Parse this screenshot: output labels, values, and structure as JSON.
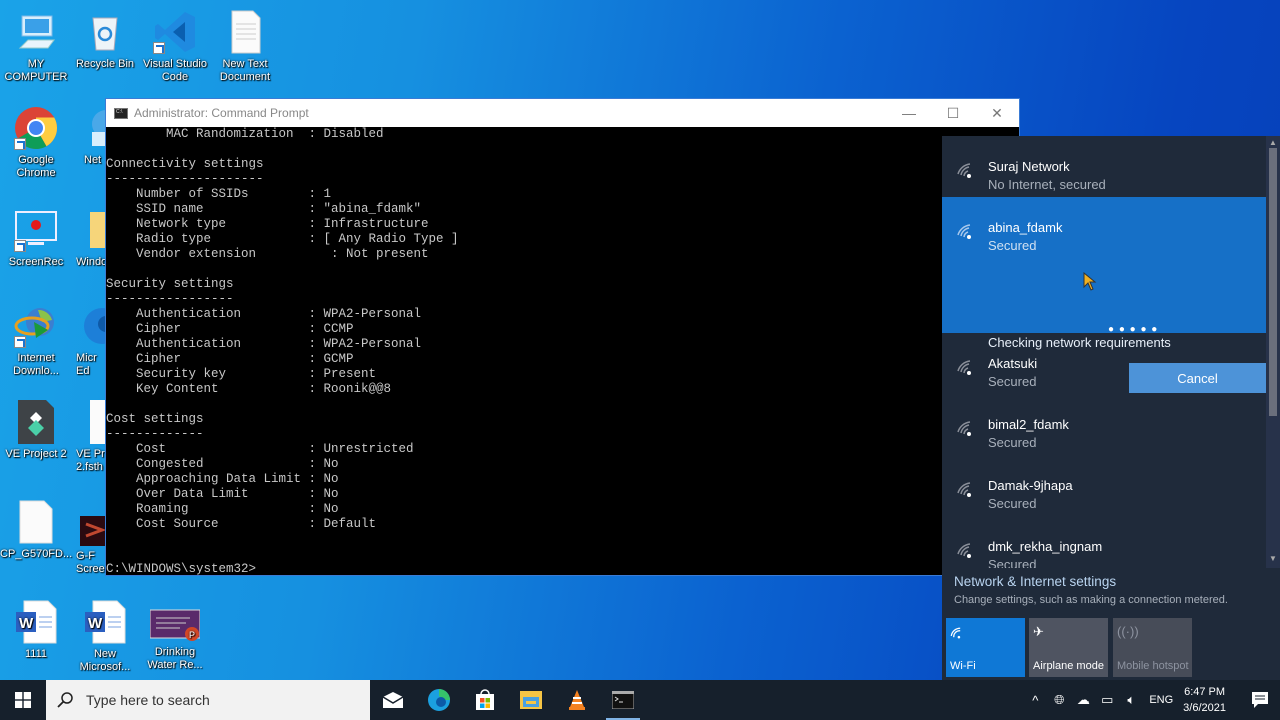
{
  "desktop": {
    "icons": [
      {
        "label": "MY COMPUTER",
        "icon": "computer-icon"
      },
      {
        "label": "Recycle Bin",
        "icon": "recycle-bin-icon"
      },
      {
        "label": "Visual Studio Code",
        "icon": "vscode-icon"
      },
      {
        "label": "New Text Document",
        "icon": "text-document-icon"
      },
      {
        "label": "Google Chrome",
        "icon": "chrome-icon"
      },
      {
        "label": "Net",
        "icon": "network-icon"
      },
      {
        "label": "ScreenRec",
        "icon": "screenrec-icon"
      },
      {
        "label": "Windo",
        "icon": "folder-icon"
      },
      {
        "label": "Internet Downlo...",
        "icon": "idm-icon"
      },
      {
        "label": "Micr Ed",
        "icon": "edge-icon"
      },
      {
        "label": "VE Project 2",
        "icon": "filmora-project-icon"
      },
      {
        "label": "VE Pr 2.fsth",
        "icon": "file-icon"
      },
      {
        "label": "CP_G570FD...",
        "icon": "file-icon"
      },
      {
        "label": "G-F Scree",
        "icon": "video-thumbnail-icon"
      },
      {
        "label": "1111",
        "icon": "word-document-icon"
      },
      {
        "label": "New Microsof...",
        "icon": "word-document-icon"
      },
      {
        "label": "Drinking Water Re...",
        "icon": "powerpoint-icon"
      }
    ]
  },
  "cmd": {
    "title": "Administrator: Command Prompt",
    "controls": {
      "minimize": "—",
      "maximize": "☐",
      "close": "✕"
    },
    "lines": [
      "        MAC Randomization  : Disabled",
      "",
      "Connectivity settings",
      "---------------------",
      "    Number of SSIDs        : 1",
      "    SSID name              : \"abina_fdamk\"",
      "    Network type           : Infrastructure",
      "    Radio type             : [ Any Radio Type ]",
      "    Vendor extension          : Not present",
      "",
      "Security settings",
      "-----------------",
      "    Authentication         : WPA2-Personal",
      "    Cipher                 : CCMP",
      "    Authentication         : WPA2-Personal",
      "    Cipher                 : GCMP",
      "    Security key           : Present",
      "    Key Content            : Roonik@@8",
      "",
      "Cost settings",
      "-------------",
      "    Cost                   : Unrestricted",
      "    Congested              : No",
      "    Approaching Data Limit : No",
      "    Over Data Limit        : No",
      "    Roaming                : No",
      "    Cost Source            : Default",
      "",
      "",
      "C:\\WINDOWS\\system32>"
    ]
  },
  "flyout": {
    "networks": [
      {
        "name": "Suraj Network",
        "status": "No Internet, secured"
      },
      {
        "name": "abina_fdamk",
        "status": "Secured",
        "progress_text": "Checking network requirements",
        "cancel_label": "Cancel"
      },
      {
        "name": "Akatsuki",
        "status": "Secured"
      },
      {
        "name": "bimal2_fdamk",
        "status": "Secured"
      },
      {
        "name": "Damak-9jhapa",
        "status": "Secured"
      },
      {
        "name": "dmk_rekha_ingnam",
        "status": "Secured"
      }
    ],
    "settings_title": "Network & Internet settings",
    "settings_subtitle": "Change settings, such as making a connection metered.",
    "quick_actions": [
      {
        "label": "Wi-Fi",
        "state": "on"
      },
      {
        "label": "Airplane mode",
        "state": "off"
      },
      {
        "label": "Mobile hotspot",
        "state": "disabled"
      }
    ]
  },
  "taskbar": {
    "search_placeholder": "Type here to search",
    "pinned": [
      "mail-icon",
      "edge-icon",
      "store-icon",
      "file-explorer-icon",
      "vlc-icon",
      "cmd-icon"
    ],
    "language": "ENG",
    "time": "6:47 PM",
    "date": "3/6/2021"
  },
  "colors": {
    "accent": "#1670c7",
    "flyout_bg": "#1f2a3a",
    "taskbar_bg": "#16202c"
  }
}
